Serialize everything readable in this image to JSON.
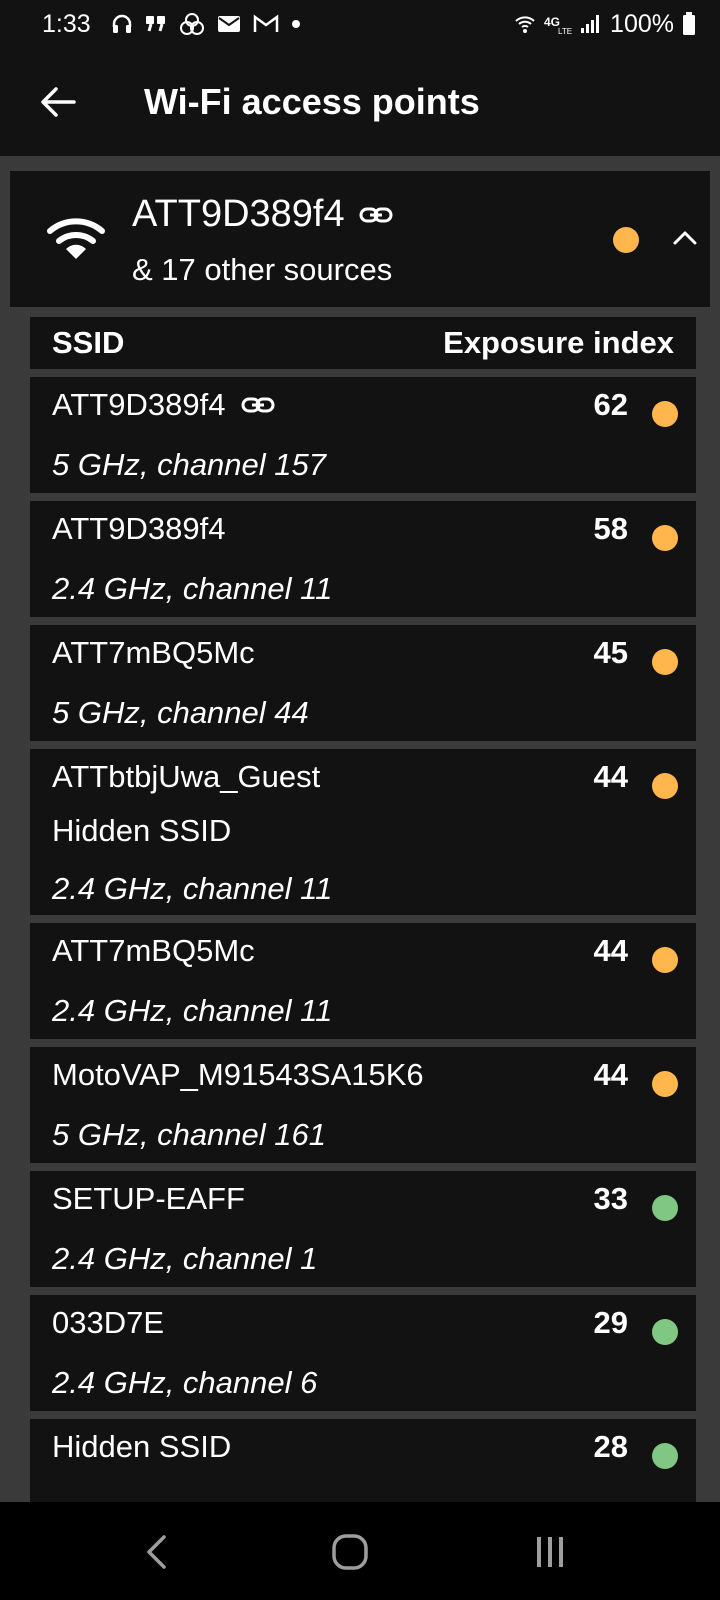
{
  "status_bar": {
    "time": "1:33",
    "left_icons": [
      "headphones-icon",
      "quote-icon",
      "app-icon",
      "mail-icon",
      "gmail-icon",
      "dot-icon"
    ],
    "right_icons": [
      "wifi-calling-icon",
      "4g-lte-icon",
      "signal-icon"
    ],
    "battery": "100%"
  },
  "app_bar": {
    "title": "Wi-Fi access points"
  },
  "group": {
    "ssid": "ATT9D389f4",
    "subtitle": "& 17 other sources",
    "dot_color": "#FFB74D"
  },
  "table": {
    "col_ssid": "SSID",
    "col_exposure": "Exposure index",
    "rows": [
      {
        "ssid": "ATT9D389f4",
        "linked": true,
        "hidden": "",
        "freq": "5 GHz, channel 157",
        "value": "62",
        "dot_color": "#FFB74D"
      },
      {
        "ssid": "ATT9D389f4",
        "linked": false,
        "hidden": "",
        "freq": "2.4 GHz, channel 11",
        "value": "58",
        "dot_color": "#FFB74D"
      },
      {
        "ssid": "ATT7mBQ5Mc",
        "linked": false,
        "hidden": "",
        "freq": "5 GHz, channel 44",
        "value": "45",
        "dot_color": "#FFB74D"
      },
      {
        "ssid": "ATTbtbjUwa_Guest",
        "linked": false,
        "hidden": "Hidden SSID",
        "freq": "2.4 GHz, channel 11",
        "value": "44",
        "dot_color": "#FFB74D"
      },
      {
        "ssid": "ATT7mBQ5Mc",
        "linked": false,
        "hidden": "",
        "freq": "2.4 GHz, channel 11",
        "value": "44",
        "dot_color": "#FFB74D"
      },
      {
        "ssid": "MotoVAP_M91543SA15K6",
        "linked": false,
        "hidden": "",
        "freq": "5 GHz, channel 161",
        "value": "44",
        "dot_color": "#FFB74D"
      },
      {
        "ssid": "SETUP-EAFF",
        "linked": false,
        "hidden": "",
        "freq": "2.4 GHz, channel 1",
        "value": "33",
        "dot_color": "#81C784"
      },
      {
        "ssid": "033D7E",
        "linked": false,
        "hidden": "",
        "freq": "2.4 GHz, channel 6",
        "value": "29",
        "dot_color": "#81C784"
      },
      {
        "ssid": "Hidden SSID",
        "linked": false,
        "hidden": "",
        "freq": "",
        "value": "28",
        "dot_color": "#81C784"
      }
    ]
  },
  "nav_bar": {
    "buttons": [
      "back-nav-icon",
      "home-nav-icon",
      "recents-nav-icon"
    ]
  }
}
